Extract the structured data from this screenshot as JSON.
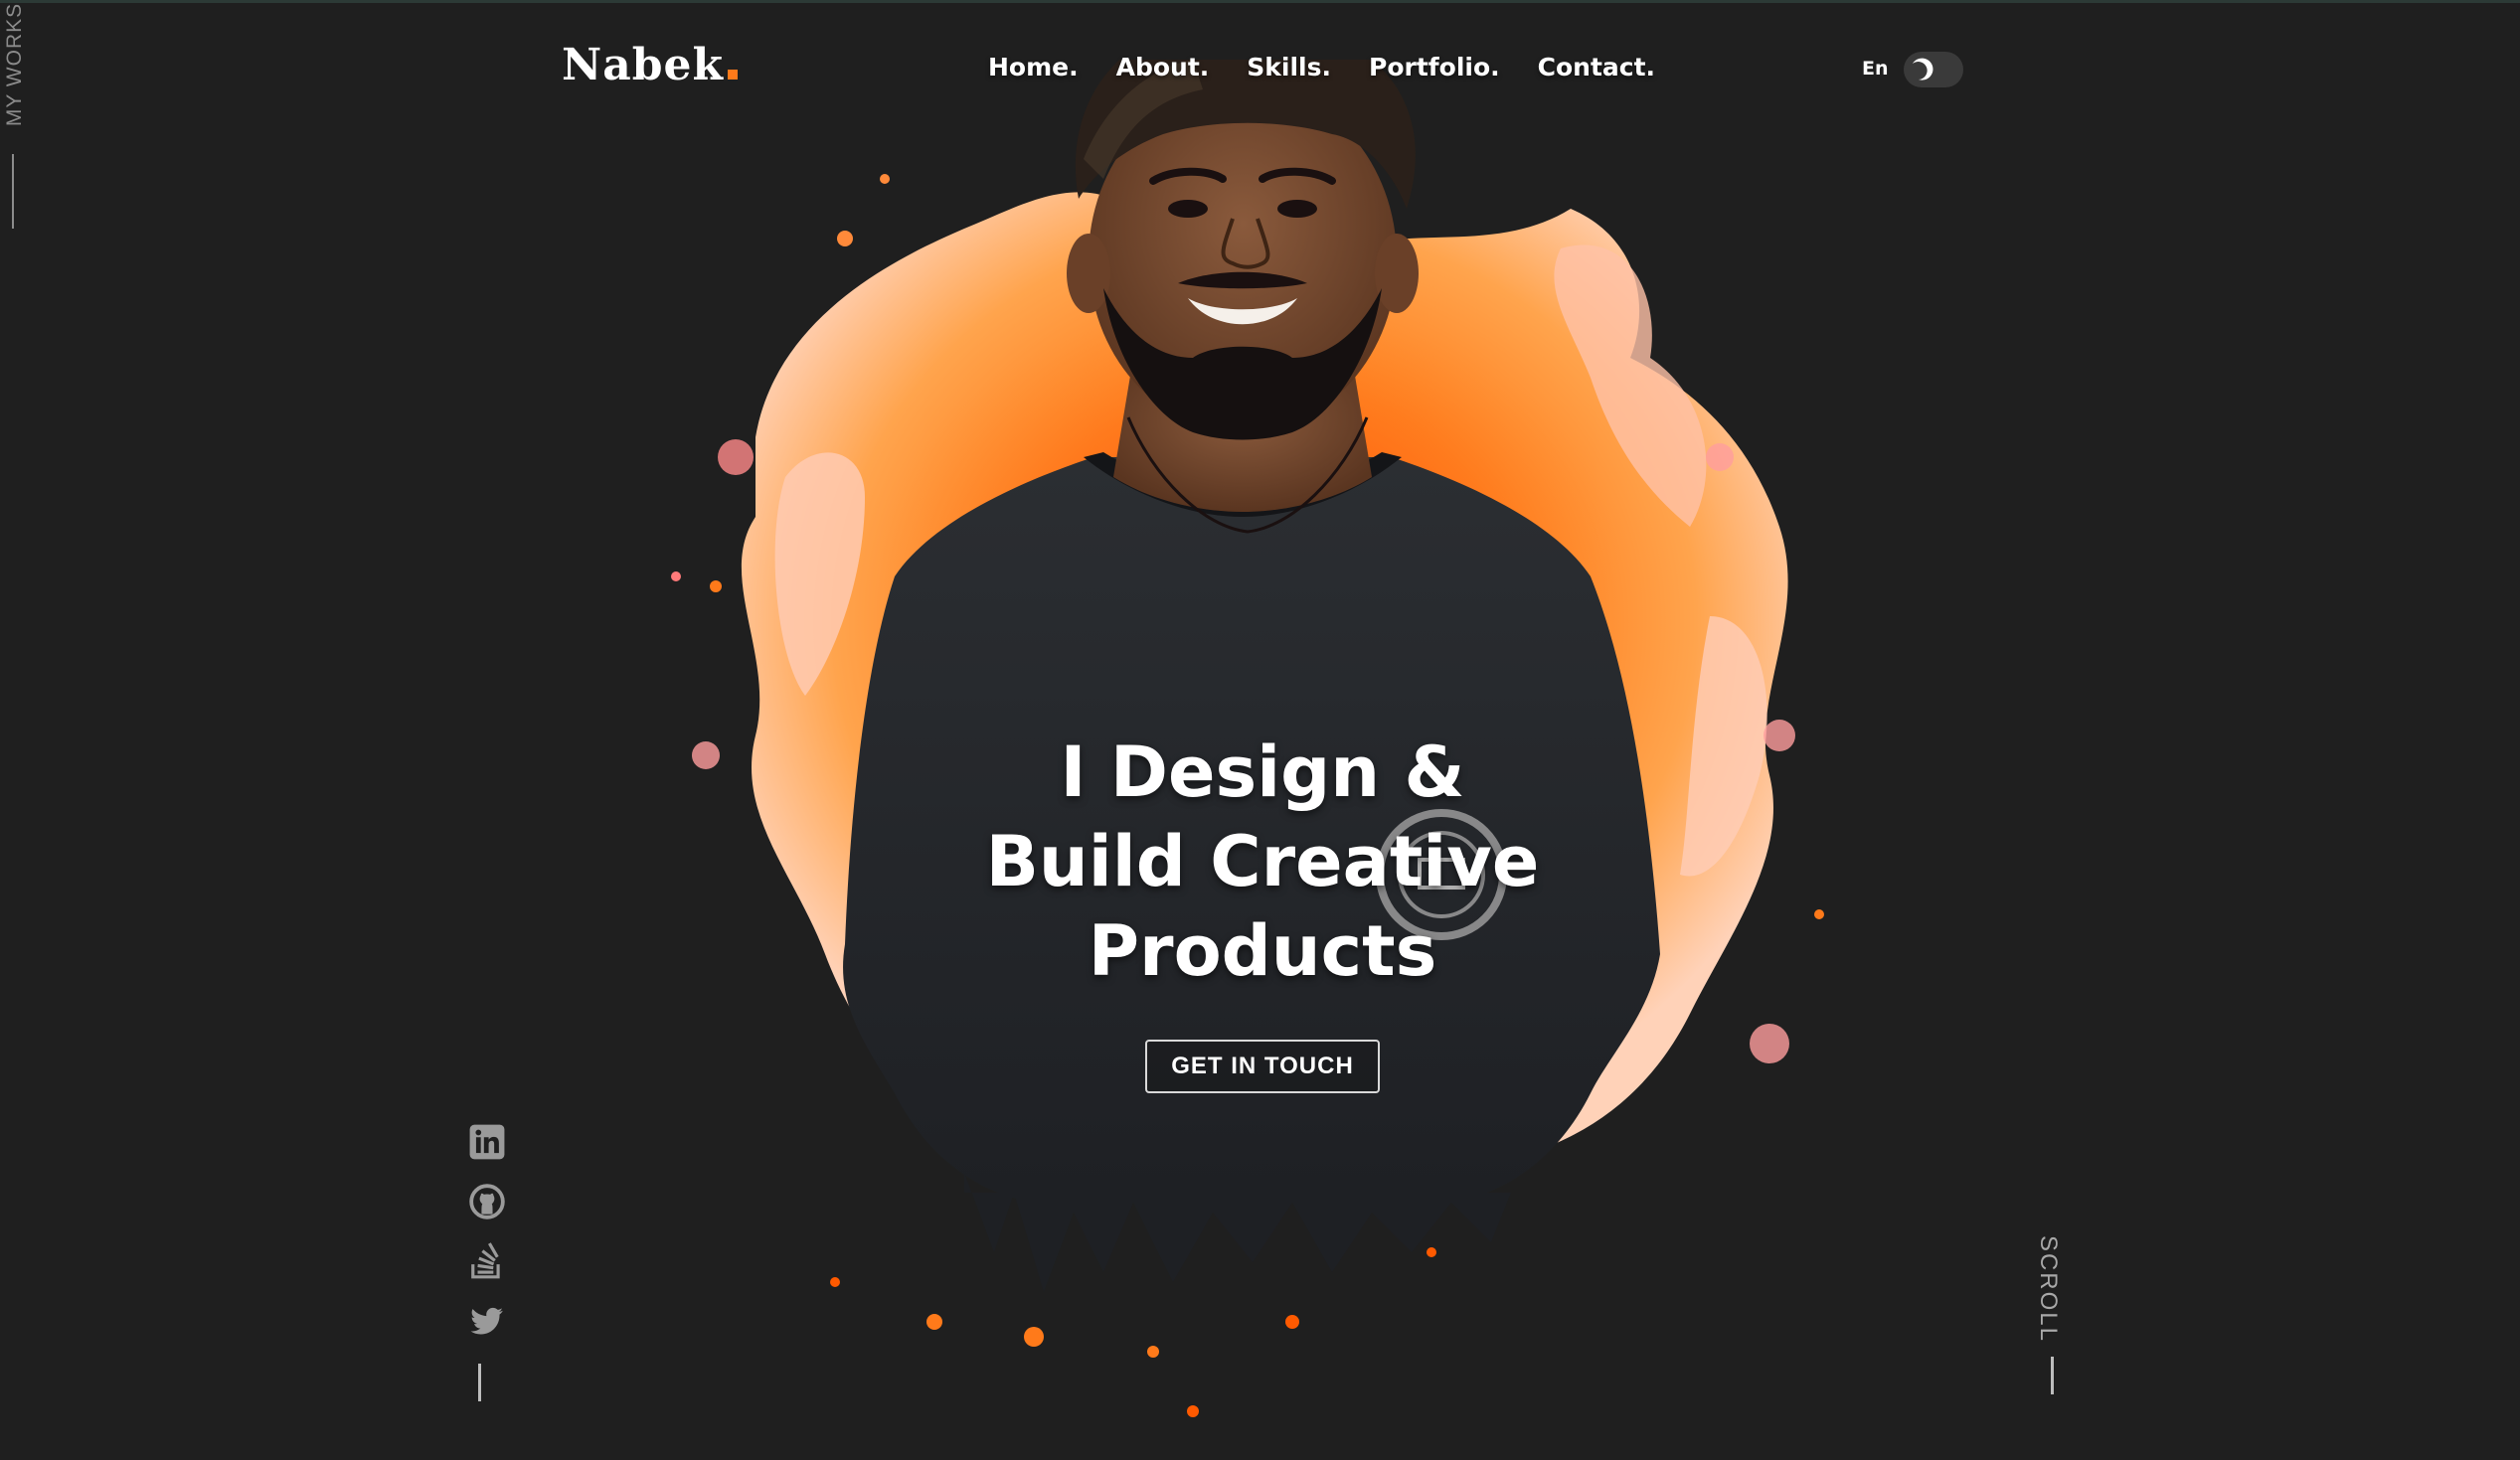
{
  "side": {
    "my_works": "MY WORKS",
    "scroll": "SCROLL"
  },
  "header": {
    "logo": "Nabek",
    "nav": [
      {
        "label": "Home."
      },
      {
        "label": "About."
      },
      {
        "label": "Skills."
      },
      {
        "label": "Portfolio."
      },
      {
        "label": "Contact."
      }
    ],
    "language": "En",
    "theme_toggle_icon": "moon-icon"
  },
  "hero": {
    "headline_lines": [
      "I Design &",
      "Build Creative",
      "Products"
    ],
    "cta_label": "GET IN TOUCH",
    "portrait_description_icon": "portrait-photo"
  },
  "social": [
    {
      "icon": "linkedin-icon"
    },
    {
      "icon": "github-icon"
    },
    {
      "icon": "stackoverflow-icon"
    },
    {
      "icon": "twitter-icon"
    }
  ],
  "colors": {
    "background": "#1f1f1f",
    "accent": "#ff7a1a",
    "text": "#ffffff",
    "muted": "#8b8b8b"
  }
}
